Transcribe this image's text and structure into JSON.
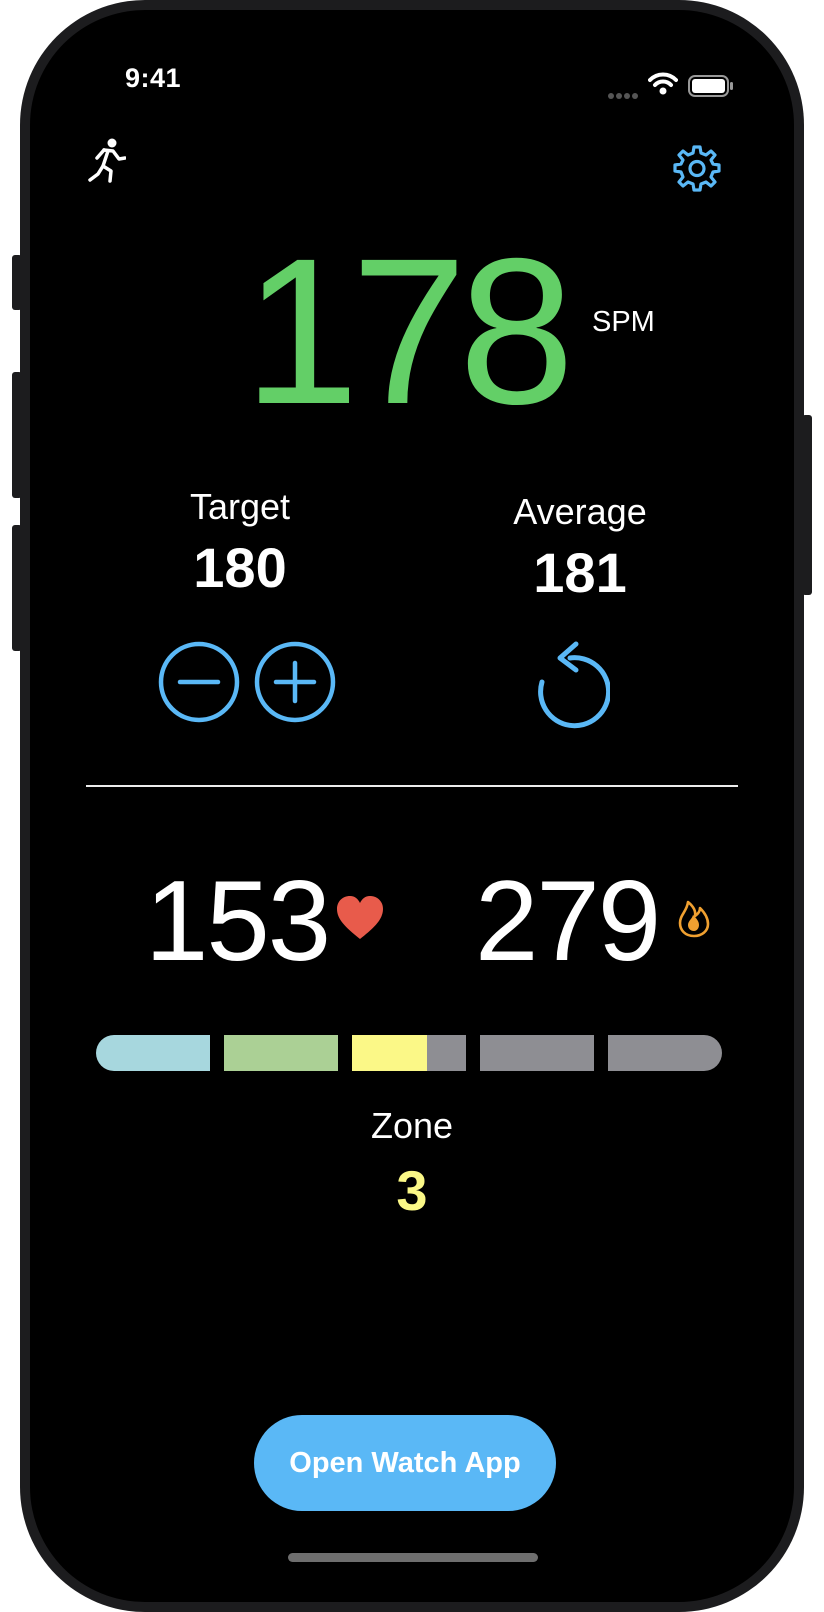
{
  "status_bar": {
    "time": "9:41"
  },
  "cadence": {
    "value": "178",
    "unit": "SPM"
  },
  "target": {
    "label": "Target",
    "value": "180"
  },
  "average": {
    "label": "Average",
    "value": "181"
  },
  "heart_rate": {
    "value": "153"
  },
  "calories": {
    "value": "279"
  },
  "zone": {
    "label": "Zone",
    "value": "3",
    "segments": [
      {
        "color": "#a7d7de"
      },
      {
        "color": "#abd095"
      },
      {
        "color": "#fbf887",
        "partial_fill": 0.66,
        "rest_color": "#8e8e93"
      },
      {
        "color": "#8e8e93"
      },
      {
        "color": "#8e8e93"
      }
    ]
  },
  "actions": {
    "open_watch_app": "Open Watch App"
  },
  "colors": {
    "accent": "#5ab8f6",
    "cadence": "#63cf67",
    "heart": "#e85b4b",
    "flame": "#f0a030",
    "zone_value": "#fbf887"
  }
}
